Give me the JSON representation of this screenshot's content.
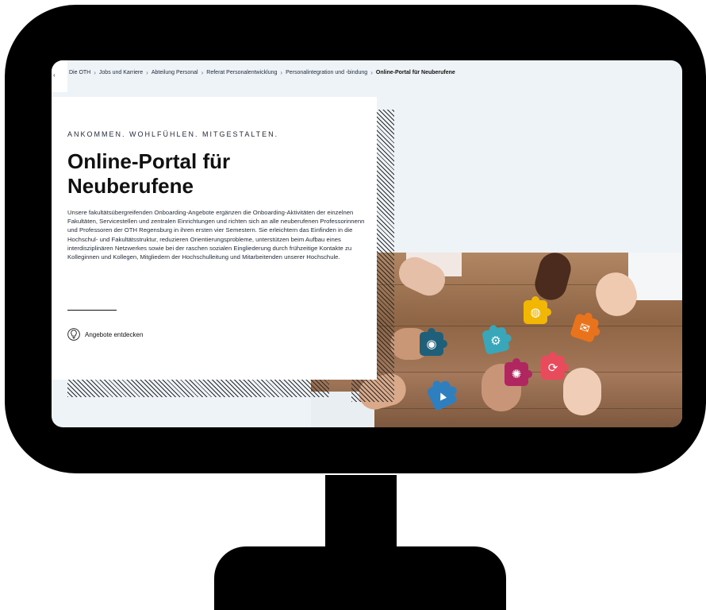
{
  "breadcrumb": {
    "items": [
      "Die OTH",
      "Jobs und Karriere",
      "Abteilung Personal",
      "Referat Personalentwicklung",
      "Personalintegration und -bindung"
    ],
    "current": "Online-Portal für Neuberufene",
    "separator": "›"
  },
  "hero": {
    "eyebrow": "ANKOMMEN. WOHLFÜHLEN. MITGESTALTEN.",
    "title": "Online-Portal für Neuberufene",
    "body": "Unsere fakultätsübergreifenden Onboarding-Angebote ergänzen die Onboarding-Aktivitäten der einzelnen Fakultäten, Servicestellen und zentralen Einrichtungen und richten sich an alle neuberufenen Professorinnenn und Professoren der OTH Regensburg in ihren ersten vier Semestern. Sie erleichtern das Einfinden in die Hochschul- und Fakultätsstruktur, reduzieren Orientierungsprobleme, unterstützen beim Aufbau eines interdisziplinären Netzwerkes sowie bei der raschen sozialen Eingliederung durch frühzeitige Kontakte zu Kolleginnen und Kollegen, Mitgliedern der Hochschulleitung und Mitarbeitenden unserer Hochschule.",
    "cta_label": "Angebote entdecken",
    "cta_icon": "lightbulb-icon"
  },
  "image": {
    "subject": "hands-holding-puzzle-pieces",
    "pieces": [
      {
        "color": "#1f5f7a",
        "icon": "eye-icon",
        "glyph": "◉"
      },
      {
        "color": "#3aa6b9",
        "icon": "gears-icon",
        "glyph": "⚙"
      },
      {
        "color": "#f2b705",
        "icon": "globe-icon",
        "glyph": "◍"
      },
      {
        "color": "#e8731c",
        "icon": "mail-icon",
        "glyph": "✉"
      },
      {
        "color": "#b0265f",
        "icon": "lightbulb-icon",
        "glyph": "✺"
      },
      {
        "color": "#e84b5c",
        "icon": "refresh-icon",
        "glyph": "⟳"
      },
      {
        "color": "#2f7fbf",
        "icon": "chart-icon",
        "glyph": "▲"
      }
    ]
  },
  "colors": {
    "screen_bg": "#eef3f8",
    "card_bg": "#ffffff",
    "frame": "#000000"
  }
}
